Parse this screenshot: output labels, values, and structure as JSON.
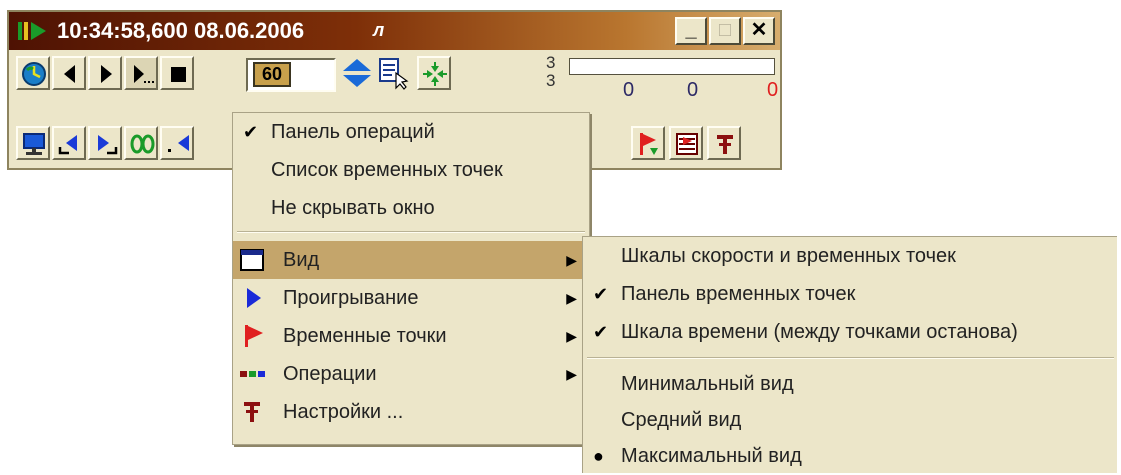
{
  "window": {
    "title": "10:34:58,600 08.06.2006",
    "title_suffix": "л",
    "buttons": {
      "minimize": "_",
      "maximize": "□",
      "close": "✕"
    }
  },
  "toolbar": {
    "speed_value": "60",
    "counter_top": "3",
    "counter_bottom": "3",
    "values": [
      "0",
      "0",
      "0"
    ],
    "accent_red": "#e02020",
    "accent_blue": "#1010c8",
    "accent_green": "#1a9b2a"
  },
  "menu": {
    "items": [
      {
        "label": "Панель операций",
        "checked": true
      },
      {
        "label": "Список временных точек",
        "checked": false
      },
      {
        "label": "Не скрывать окно",
        "checked": false
      }
    ],
    "submenus": [
      {
        "label": "Вид",
        "icon": "window-icon",
        "highlighted": true
      },
      {
        "label": "Проигрывание",
        "icon": "play-icon"
      },
      {
        "label": "Временные точки",
        "icon": "red-flag-icon"
      },
      {
        "label": "Операции",
        "icon": "operations-icon"
      },
      {
        "label": "Настройки ...",
        "icon": "settings-icon"
      }
    ]
  },
  "view_submenu": {
    "items": [
      {
        "label": "Шкалы скорости и временных точек",
        "mark": ""
      },
      {
        "label": "Панель временных точек",
        "mark": "✔"
      },
      {
        "label": "Шкала времени (между точками останова)",
        "mark": "✔"
      }
    ],
    "modes": [
      {
        "label": "Минимальный вид",
        "mark": ""
      },
      {
        "label": "Средний вид",
        "mark": ""
      },
      {
        "label": "Максимальный вид",
        "mark": "●"
      }
    ]
  }
}
